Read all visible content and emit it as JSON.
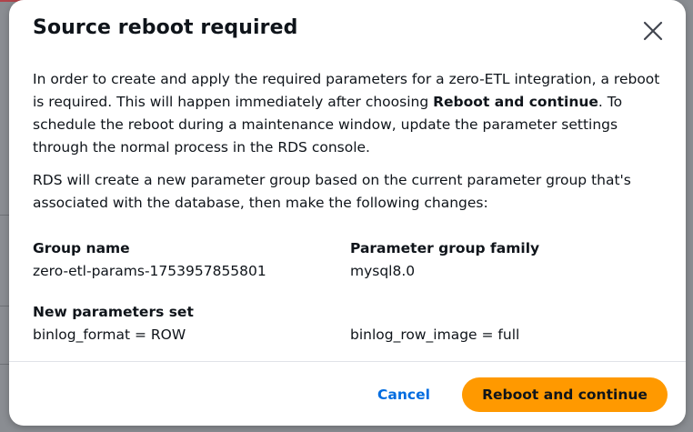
{
  "modal": {
    "title": "Source reboot required",
    "close_icon": "close-icon",
    "paragraph1_before": "In order to create and apply the required parameters for a zero-ETL integration, a reboot is required. This will happen immediately after choosing ",
    "paragraph1_bold": "Reboot and continue",
    "paragraph1_after": ". To schedule the reboot during a maintenance window, update the parameter settings through the normal process in the RDS console.",
    "paragraph2": "RDS will create a new parameter group based on the current parameter group that's associated with the database, then make the following changes:",
    "group_name": {
      "label": "Group name",
      "value": "zero-etl-params-1753957855801"
    },
    "parameter_group_family": {
      "label": "Parameter group family",
      "value": "mysql8.0"
    },
    "new_parameters_set": {
      "label": "New parameters set",
      "values": [
        "binlog_format = ROW",
        "binlog_row_image = full"
      ]
    },
    "footer": {
      "cancel_label": "Cancel",
      "primary_label": "Reboot and continue"
    }
  },
  "colors": {
    "primary_button": "#ff9900",
    "link": "#006ce0",
    "text": "#0f141a",
    "overlay": "#7f8287"
  }
}
